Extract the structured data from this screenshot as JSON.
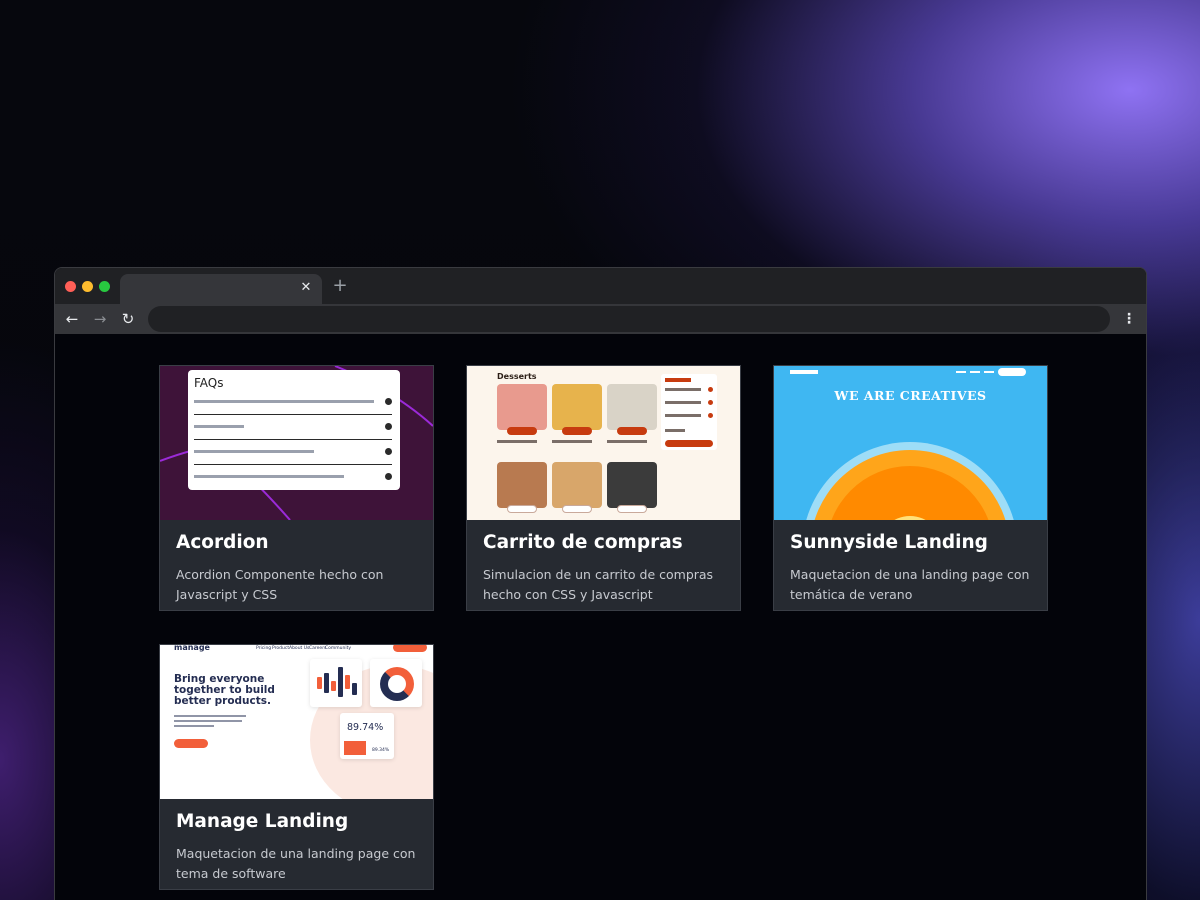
{
  "browser": {
    "tab_close_glyph": "✕",
    "new_tab_glyph": "+",
    "back_glyph": "←",
    "forward_glyph": "→",
    "reload_glyph": "↻",
    "menu_glyph": "⋮",
    "address_value": ""
  },
  "projects": [
    {
      "title": "Acordion",
      "description": "Acordion Componente hecho con Javascript y CSS",
      "thumb": {
        "heading": "FAQs"
      }
    },
    {
      "title": "Carrito de compras",
      "description": "Simulacion de un carrito de compras hecho con CSS y Javascript",
      "thumb": {
        "heading": "Desserts"
      }
    },
    {
      "title": "Sunnyside Landing",
      "description": "Maquetacion de una landing page con temática de verano",
      "thumb": {
        "heading": "WE ARE CREATIVES"
      }
    },
    {
      "title": "Manage Landing",
      "description": "Maquetacion de una landing page con tema de software",
      "thumb": {
        "brand": "manage",
        "nav": [
          "Pricing",
          "Product",
          "About Us",
          "Careers",
          "Community"
        ],
        "headline": "Bring everyone together to build better products.",
        "stat": "89.74%",
        "stat_small": "89.34%"
      }
    }
  ],
  "colors": {
    "card_bg": "#262a31",
    "page_bg": "#03040a",
    "accent_orange": "#f25f3a",
    "sky_blue": "#3fb7f2"
  }
}
